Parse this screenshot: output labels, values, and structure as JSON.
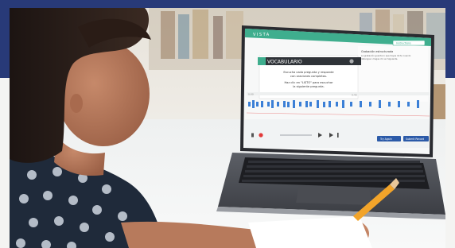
{
  "screen": {
    "app_name": "VISTA",
    "side_button": "Instructions",
    "side_heading": "Grabación estructurada",
    "side_text_1": "La grabación guarda lo que hayas dicho cuando",
    "side_text_2": "detengas o hagas clic en Siguiente.",
    "banner": "VOCABULARIO",
    "instruction_1": "Escucha cada pregunta y responde",
    "instruction_2": "con oraciones completas.",
    "instruction_3": "Haz clic en \"LISTO\" para escuchar",
    "instruction_4": "la siguiente pregunta.",
    "time_start": "0:00",
    "time_end": "0:45",
    "btn_left": "Try Again",
    "btn_right": "Submit Record",
    "accent": "#3fae8e",
    "wave_color": "#3b7fd6",
    "record_color": "#e23838"
  }
}
